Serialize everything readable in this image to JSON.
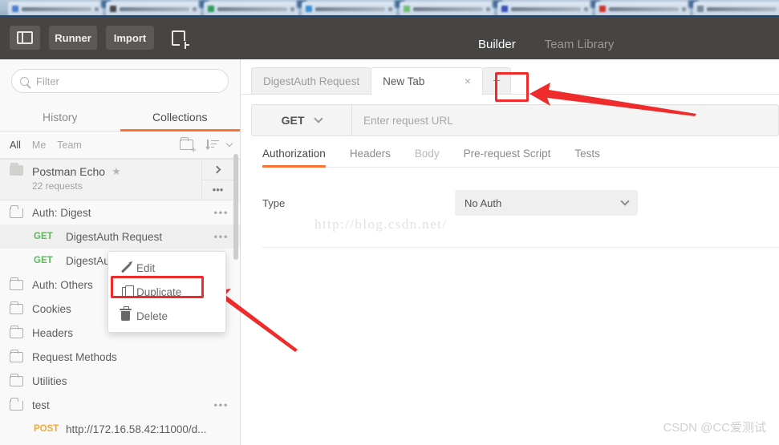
{
  "browser": {
    "tabs": [
      {
        "favicon": "#4c7fd0"
      },
      {
        "favicon": "#4a4a4a"
      },
      {
        "favicon": "#2f9e5f"
      },
      {
        "favicon": "#3a8fd8"
      },
      {
        "favicon": "#6fbf73"
      },
      {
        "favicon": "#3b4fc0"
      },
      {
        "favicon": "#d0342c"
      },
      {
        "favicon": "#7a8b9a"
      }
    ]
  },
  "header": {
    "sidebar_toggle_icon": "panel-toggle-icon",
    "runner_label": "Runner",
    "import_label": "Import",
    "new_window_icon": "new-window-plus-icon",
    "nav": [
      {
        "label": "Builder",
        "active": true
      },
      {
        "label": "Team Library",
        "active": false
      }
    ],
    "accent_color": "#ff7236",
    "background_color": "#474543"
  },
  "sidebar": {
    "search": {
      "placeholder": "Filter",
      "value": "",
      "icon": "search-icon"
    },
    "tabs": [
      {
        "label": "History",
        "active": false
      },
      {
        "label": "Collections",
        "active": true
      }
    ],
    "scopes": [
      {
        "label": "All",
        "active": true
      },
      {
        "label": "Me",
        "active": false
      },
      {
        "label": "Team",
        "active": false
      }
    ],
    "new_folder_icon": "new-folder-icon",
    "sort_icon": "sort-icon",
    "featured": {
      "title": "Postman Echo",
      "subtitle": "22 requests",
      "star_icon": "★",
      "expand_icon": "chevron-right-icon",
      "more_icon": "•••"
    },
    "items": [
      {
        "type": "folder",
        "label": "Auth: Digest",
        "open": true,
        "more": "•••"
      },
      {
        "type": "request",
        "method": "GET",
        "label": "DigestAuth Request",
        "selected": true,
        "more": "•••"
      },
      {
        "type": "request",
        "method": "GET",
        "label": "DigestAuth Request",
        "selected": false,
        "more": ""
      },
      {
        "type": "folder",
        "label": "Auth: Others",
        "open": false,
        "more": ""
      },
      {
        "type": "folder",
        "label": "Cookies",
        "open": false,
        "more": ""
      },
      {
        "type": "folder",
        "label": "Headers",
        "open": false,
        "more": ""
      },
      {
        "type": "folder",
        "label": "Request Methods",
        "open": false,
        "more": ""
      },
      {
        "type": "folder",
        "label": "Utilities",
        "open": false,
        "more": ""
      },
      {
        "type": "folder",
        "label": "test",
        "open": true,
        "more": "•••"
      },
      {
        "type": "request",
        "method": "POST",
        "label": "http://172.16.58.42:11000/d...",
        "selected": false,
        "more": ""
      }
    ]
  },
  "context_menu": {
    "items": [
      {
        "label": "Edit",
        "icon": "pencil-icon",
        "highlighted": false
      },
      {
        "label": "Duplicate",
        "icon": "duplicate-icon",
        "highlighted": true
      },
      {
        "label": "Delete",
        "icon": "trash-icon",
        "highlighted": false
      }
    ],
    "highlight_color": "#ef2b2b"
  },
  "main": {
    "tabs": [
      {
        "label": "DigestAuth Request",
        "active": false,
        "closable": false
      },
      {
        "label": "New Tab",
        "active": true,
        "closable": true,
        "close_icon": "×"
      }
    ],
    "add_tab_label": "+",
    "request": {
      "method": "GET",
      "method_chevron": "chevron-down-icon",
      "url_placeholder": "Enter request URL",
      "url_value": ""
    },
    "request_tabs": [
      {
        "label": "Authorization",
        "active": true,
        "dim": false
      },
      {
        "label": "Headers",
        "active": false,
        "dim": false
      },
      {
        "label": "Body",
        "active": false,
        "dim": true
      },
      {
        "label": "Pre-request Script",
        "active": false,
        "dim": false
      },
      {
        "label": "Tests",
        "active": false,
        "dim": false
      }
    ],
    "authorization": {
      "type_label": "Type",
      "type_value": "No Auth",
      "type_chevron": "chevron-down-icon"
    }
  },
  "watermarks": {
    "url": "http://blog.csdn.net/",
    "author": "CSDN @CC爱测试"
  },
  "annotations": {
    "arrow_color": "#ef2b2b",
    "arrow_to_add_tab": "arrow-pointing-to-add-tab-button",
    "arrow_to_duplicate": "arrow-pointing-to-duplicate-menu-item"
  }
}
